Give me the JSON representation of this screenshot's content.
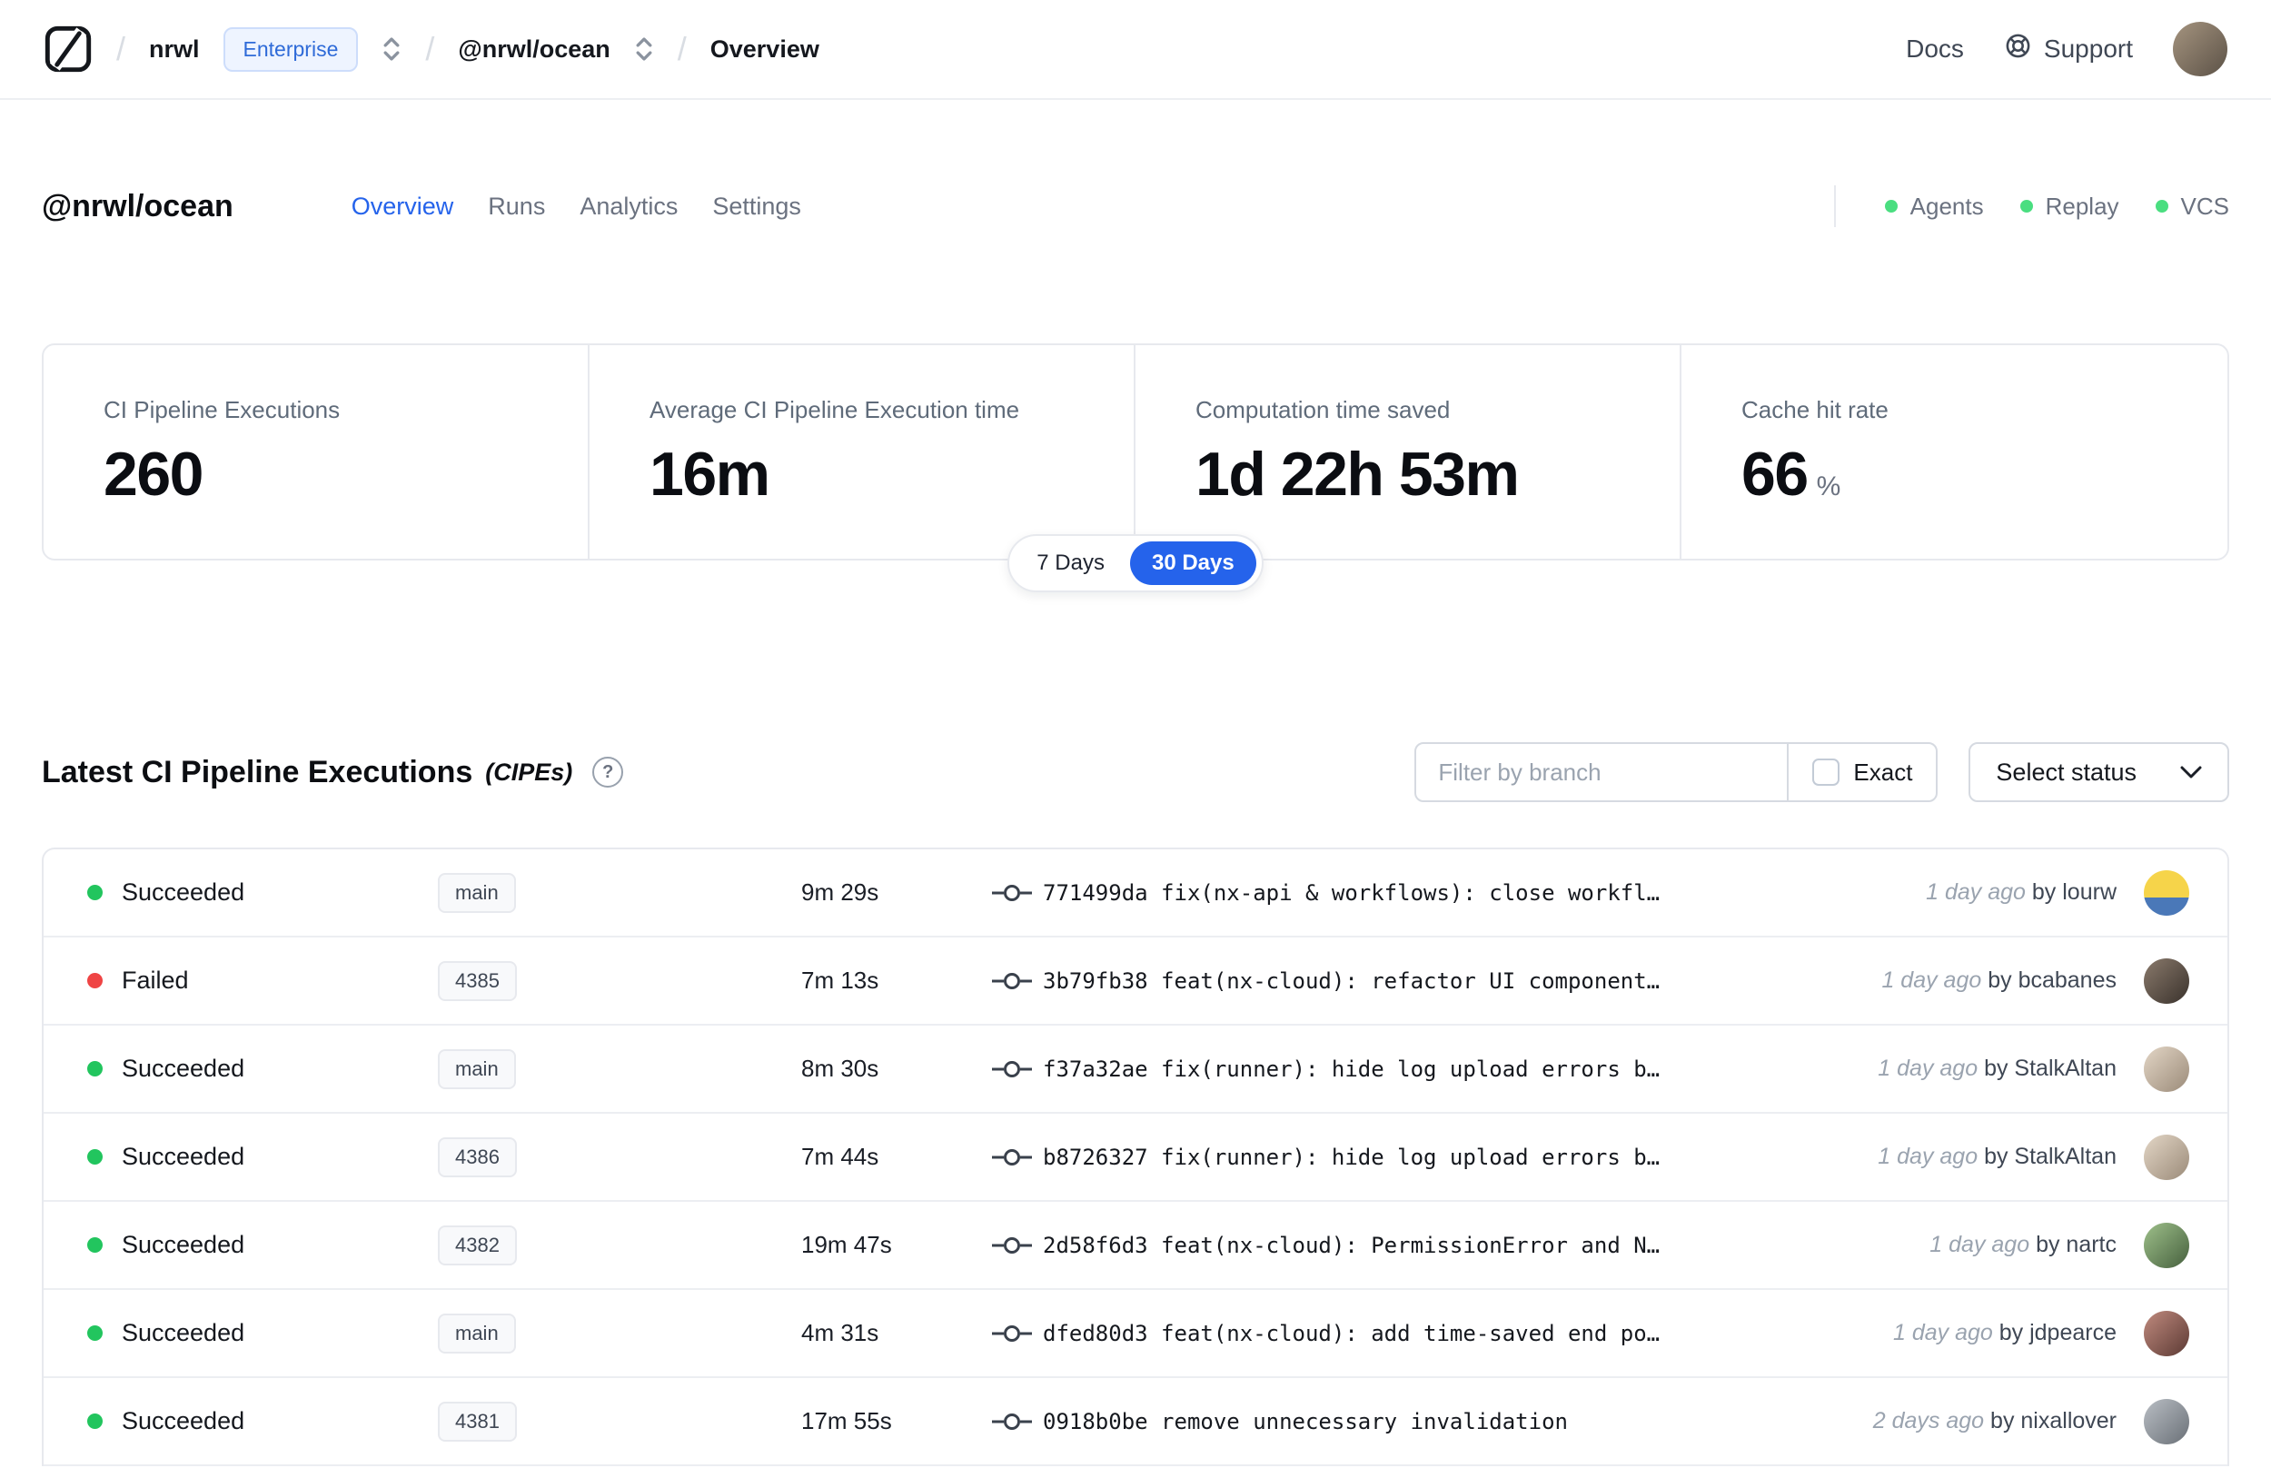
{
  "navbar": {
    "breadcrumb": {
      "org": "nrwl",
      "org_badge": "Enterprise",
      "workspace": "@nrwl/ocean",
      "page": "Overview"
    },
    "links": {
      "docs": "Docs",
      "support": "Support"
    }
  },
  "workspace_header": {
    "title": "@nrwl/ocean",
    "tabs": [
      {
        "label": "Overview",
        "active": true
      },
      {
        "label": "Runs",
        "active": false
      },
      {
        "label": "Analytics",
        "active": false
      },
      {
        "label": "Settings",
        "active": false
      }
    ],
    "statuses": [
      {
        "label": "Agents"
      },
      {
        "label": "Replay"
      },
      {
        "label": "VCS"
      }
    ]
  },
  "metrics": {
    "cards": [
      {
        "label": "CI Pipeline Executions",
        "value": "260"
      },
      {
        "label": "Average CI Pipeline Execution time",
        "value": "16m"
      },
      {
        "label": "Computation time saved",
        "value": "1d 22h 53m"
      },
      {
        "label": "Cache hit rate",
        "value": "66",
        "suffix": "%"
      }
    ],
    "range_toggle": {
      "options": [
        "7 Days",
        "30 Days"
      ],
      "selected": "30 Days"
    }
  },
  "cipe_section": {
    "title": "Latest CI Pipeline Executions",
    "title_suffix": "(CIPEs)",
    "filter_placeholder": "Filter by branch",
    "exact_label": "Exact",
    "status_dropdown_label": "Select status",
    "rows": [
      {
        "status": "Succeeded",
        "branch": "main",
        "duration": "9m 29s",
        "commit": "771499da fix(nx-api & workflows): close workfl…",
        "time": "1 day ago",
        "author": "by lourw"
      },
      {
        "status": "Failed",
        "branch": "4385",
        "duration": "7m 13s",
        "commit": "3b79fb38 feat(nx-cloud): refactor UI component…",
        "time": "1 day ago",
        "author": "by bcabanes"
      },
      {
        "status": "Succeeded",
        "branch": "main",
        "duration": "8m 30s",
        "commit": "f37a32ae fix(runner): hide log upload errors b…",
        "time": "1 day ago",
        "author": "by StalkAltan"
      },
      {
        "status": "Succeeded",
        "branch": "4386",
        "duration": "7m 44s",
        "commit": "b8726327 fix(runner): hide log upload errors b…",
        "time": "1 day ago",
        "author": "by StalkAltan"
      },
      {
        "status": "Succeeded",
        "branch": "4382",
        "duration": "19m 47s",
        "commit": "2d58f6d3 feat(nx-cloud): PermissionError and N…",
        "time": "1 day ago",
        "author": "by nartc"
      },
      {
        "status": "Succeeded",
        "branch": "main",
        "duration": "4m 31s",
        "commit": "dfed80d3 feat(nx-cloud): add time-saved end po…",
        "time": "1 day ago",
        "author": "by jdpearce"
      },
      {
        "status": "Succeeded",
        "branch": "4381",
        "duration": "17m 55s",
        "commit": "0918b0be remove unnecessary invalidation",
        "time": "2 days ago",
        "author": "by nixallover"
      }
    ]
  },
  "icons": {
    "logo": "nx-cloud-logo",
    "breadcrumb_selector": "chevron-up-down",
    "support": "lifebuoy",
    "help": "question-circle",
    "select_chevron": "chevron-down",
    "commit": "git-commit",
    "checkbox": "checkbox-unchecked"
  },
  "colors": {
    "accent_blue": "#2563eb",
    "success_green": "#22c55e",
    "failure_red": "#ef4444",
    "status_dot_green": "#4ade80",
    "enterprise_badge_bg": "#eef4ff",
    "enterprise_badge_text": "#2f6bd8"
  }
}
